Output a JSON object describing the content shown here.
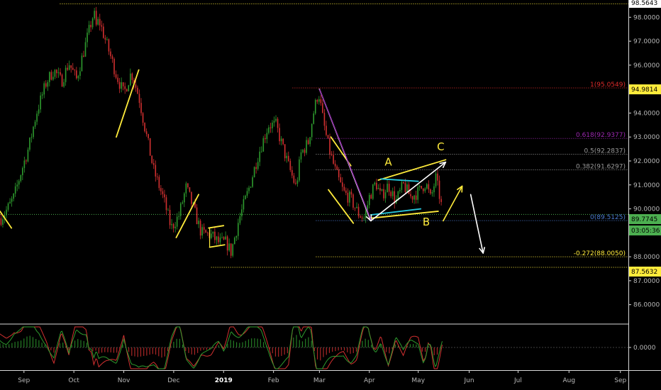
{
  "chart_data": {
    "type": "candlestick",
    "x_ticks": [
      {
        "label": "Sep",
        "t": 0.0
      },
      {
        "label": "Oct",
        "t": 1.0
      },
      {
        "label": "Nov",
        "t": 2.0
      },
      {
        "label": "Dec",
        "t": 3.0
      },
      {
        "label": "2019",
        "t": 4.0,
        "bold": true
      },
      {
        "label": "Feb",
        "t": 5.0
      },
      {
        "label": "Mar",
        "t": 5.92
      },
      {
        "label": "Apr",
        "t": 6.92
      },
      {
        "label": "May",
        "t": 7.9
      },
      {
        "label": "Jun",
        "t": 8.92
      },
      {
        "label": "Jul",
        "t": 9.9
      },
      {
        "label": "Aug",
        "t": 10.92
      },
      {
        "label": "Sep",
        "t": 11.95
      }
    ],
    "x_range": [
      -0.48,
      12.11
    ],
    "y_range": [
      85.25,
      98.72
    ],
    "y_ticks": [
      {
        "label": "86.0000",
        "v": 86
      },
      {
        "label": "87.0000",
        "v": 87
      },
      {
        "label": "88.0000",
        "v": 88
      },
      {
        "label": "89.0000",
        "v": 89
      },
      {
        "label": "90.0000",
        "v": 90
      },
      {
        "label": "91.0000",
        "v": 91
      },
      {
        "label": "92.0000",
        "v": 92
      },
      {
        "label": "93.0000",
        "v": 93
      },
      {
        "label": "94.0000",
        "v": 94
      },
      {
        "label": "95.0000",
        "v": 95
      },
      {
        "label": "96.0000",
        "v": 96
      },
      {
        "label": "97.0000",
        "v": 97
      },
      {
        "label": "98.0000",
        "v": 98
      }
    ],
    "price_path": [
      [
        -0.48,
        89.55
      ],
      [
        -0.3,
        90.1
      ],
      [
        -0.2,
        90.5
      ],
      [
        -0.05,
        91.6
      ],
      [
        0.1,
        92.6
      ],
      [
        0.25,
        94.0
      ],
      [
        0.45,
        95.3
      ],
      [
        0.6,
        95.8
      ],
      [
        0.75,
        95.3
      ],
      [
        0.9,
        96.1
      ],
      [
        1.05,
        95.4
      ],
      [
        1.2,
        96.6
      ],
      [
        1.3,
        97.4
      ],
      [
        1.4,
        98.2
      ],
      [
        1.45,
        97.6
      ],
      [
        1.5,
        97.9
      ],
      [
        1.7,
        96.6
      ],
      [
        1.85,
        95.6
      ],
      [
        2.0,
        94.8
      ],
      [
        2.15,
        95.7
      ],
      [
        2.3,
        94.7
      ],
      [
        2.45,
        93.1
      ],
      [
        2.6,
        91.6
      ],
      [
        2.8,
        90.4
      ],
      [
        2.95,
        89.2
      ],
      [
        3.1,
        89.7
      ],
      [
        3.25,
        90.9
      ],
      [
        3.4,
        90.0
      ],
      [
        3.55,
        89.0
      ],
      [
        3.75,
        88.9
      ],
      [
        3.9,
        88.6
      ],
      [
        4.05,
        88.6
      ],
      [
        4.15,
        88.2
      ],
      [
        4.3,
        89.5
      ],
      [
        4.5,
        90.8
      ],
      [
        4.7,
        92.3
      ],
      [
        4.9,
        93.5
      ],
      [
        5.05,
        93.5
      ],
      [
        5.15,
        92.8
      ],
      [
        5.3,
        91.8
      ],
      [
        5.45,
        90.9
      ],
      [
        5.55,
        92.3
      ],
      [
        5.7,
        92.8
      ],
      [
        5.8,
        94.0
      ],
      [
        5.9,
        94.9
      ],
      [
        6.0,
        93.6
      ],
      [
        6.1,
        92.6
      ],
      [
        6.25,
        91.5
      ],
      [
        6.4,
        90.7
      ],
      [
        6.55,
        90.4
      ],
      [
        6.7,
        89.8
      ],
      [
        6.82,
        89.6
      ],
      [
        6.92,
        90.5
      ],
      [
        7.05,
        91.1
      ],
      [
        7.15,
        90.5
      ],
      [
        7.3,
        91.0
      ],
      [
        7.45,
        90.3
      ],
      [
        7.6,
        91.0
      ],
      [
        7.75,
        90.5
      ],
      [
        7.9,
        90.7
      ],
      [
        8.05,
        91.1
      ],
      [
        8.15,
        90.4
      ],
      [
        8.25,
        91.3
      ],
      [
        8.32,
        90.6
      ],
      [
        8.38,
        89.95
      ]
    ],
    "oscillator": {
      "type": "line",
      "zero_label": "0.0000",
      "range": [
        -1,
        1
      ]
    },
    "fib_levels": [
      {
        "label": "1(95.0549)",
        "value": 95.05,
        "color": "#e02a2a"
      },
      {
        "label": "0.618(92.9377)",
        "value": 92.94,
        "color": "#9c27b0"
      },
      {
        "label": "0.5(92.2837)",
        "value": 92.28,
        "color": "#9a9a9a"
      },
      {
        "label": "0.382(91.6297)",
        "value": 91.63,
        "color": "#9a9a9a"
      },
      {
        "label": "0(89.5125)",
        "value": 89.51,
        "color": "#4a7bd0"
      },
      {
        "label": "-0.272(88.0050)",
        "value": 88.0,
        "color": "#ffeb3b"
      }
    ],
    "price_boxes": [
      {
        "label": "98.5643",
        "value": 98.56,
        "bg": "#ffffff",
        "fg": "#000000"
      },
      {
        "label": "94.9814",
        "value": 94.98,
        "bg": "#ffeb3b",
        "fg": "#000000"
      },
      {
        "label": "89.7745",
        "value": 89.77,
        "bg": "#4caf50",
        "fg": "#000000"
      },
      {
        "label": "03:05:36",
        "value": 89.4,
        "bg": "#4caf50",
        "fg": "#000000"
      },
      {
        "label": "87.5632",
        "value": 87.56,
        "bg": "#ffeb3b",
        "fg": "#000000"
      }
    ],
    "horizontal_lines": [
      {
        "value": 98.56,
        "color": "#ffeb3b",
        "from": 0.72
      },
      {
        "value": 87.56,
        "color": "#ffeb3b",
        "from": 3.75
      },
      {
        "value": 89.77,
        "color": "#4caf50",
        "from": -0.48
      }
    ],
    "wave_labels": [
      {
        "label": "A",
        "t": 7.3,
        "v": 91.8
      },
      {
        "label": "B",
        "t": 8.06,
        "v": 89.3
      },
      {
        "label": "C",
        "t": 8.35,
        "v": 92.45
      }
    ],
    "colors": {
      "up": "#2e9b2e",
      "down": "#d23030",
      "annotation": "#ffeb3b",
      "arrow": "#ffffff",
      "cyan": "#26c6da",
      "oscillator_red": "#d23030",
      "oscillator_green": "#2e9b2e"
    }
  }
}
